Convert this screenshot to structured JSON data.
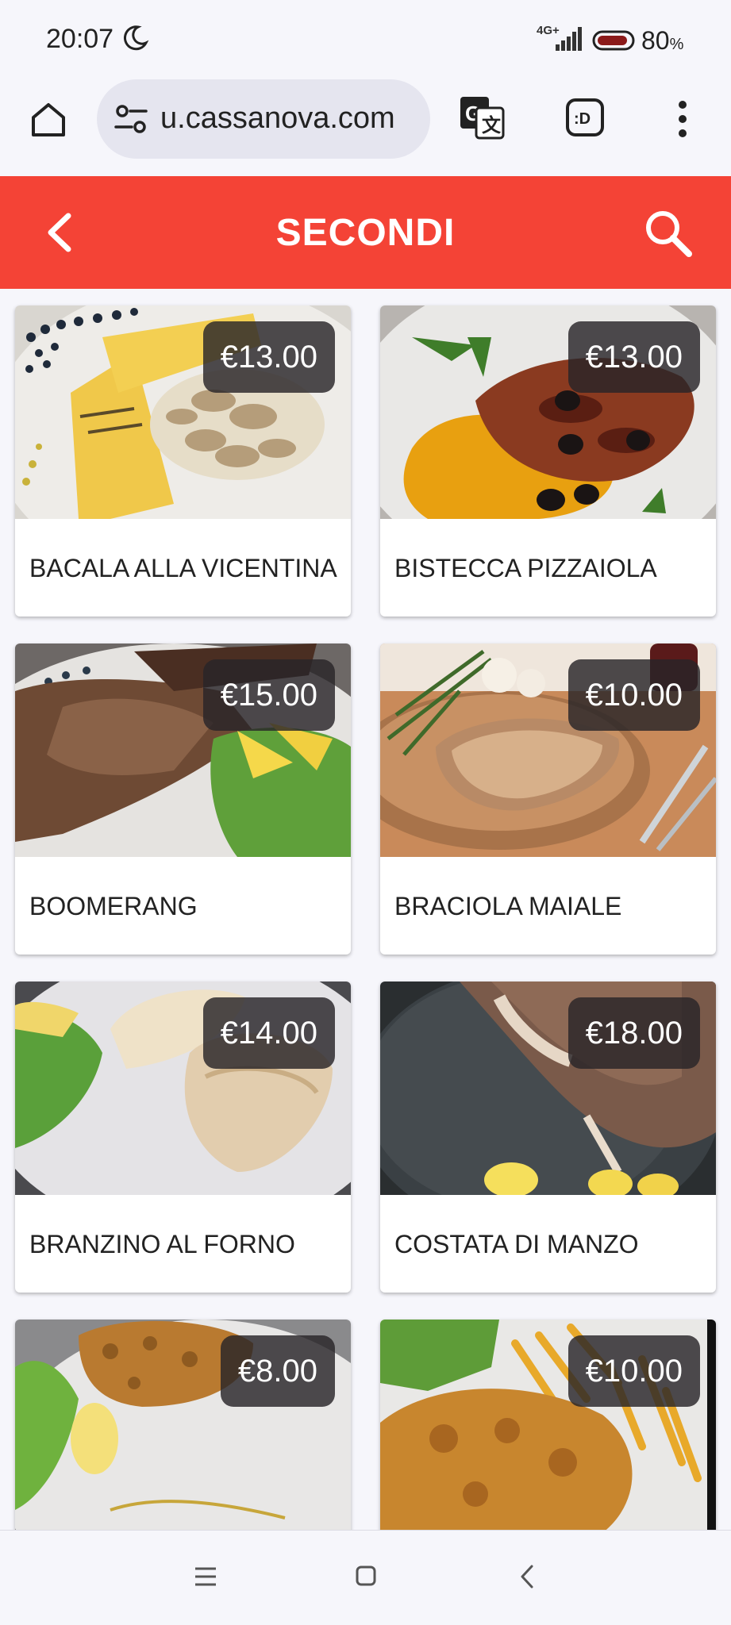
{
  "status_bar": {
    "time": "20:07",
    "network": "4G+",
    "battery": "80",
    "battery_unit": "%"
  },
  "browser": {
    "url": "u.cassanova.com",
    "icons": [
      "home-icon",
      "site-settings-icon",
      "translate-icon",
      "extension-icon",
      "more-vert-icon"
    ]
  },
  "header": {
    "title": "SECONDI",
    "back_icon": "chevron-left-icon",
    "search_icon": "search-icon",
    "color": "#f44336"
  },
  "menu_items": [
    {
      "name": "BACALA ALLA VICENTINA",
      "price": "€13.00"
    },
    {
      "name": "BISTECCA PIZZAIOLA",
      "price": "€13.00"
    },
    {
      "name": "BOOMERANG",
      "price": "€15.00"
    },
    {
      "name": "BRACIOLA MAIALE",
      "price": "€10.00"
    },
    {
      "name": "BRANZINO AL FORNO",
      "price": "€14.00"
    },
    {
      "name": "COSTATA DI MANZO",
      "price": "€18.00"
    },
    {
      "name": "",
      "price": "€8.00"
    },
    {
      "name": "",
      "price": "€10.00"
    }
  ],
  "nav": {
    "icons": [
      "recents-icon",
      "home-square-icon",
      "back-chevron-icon"
    ]
  }
}
